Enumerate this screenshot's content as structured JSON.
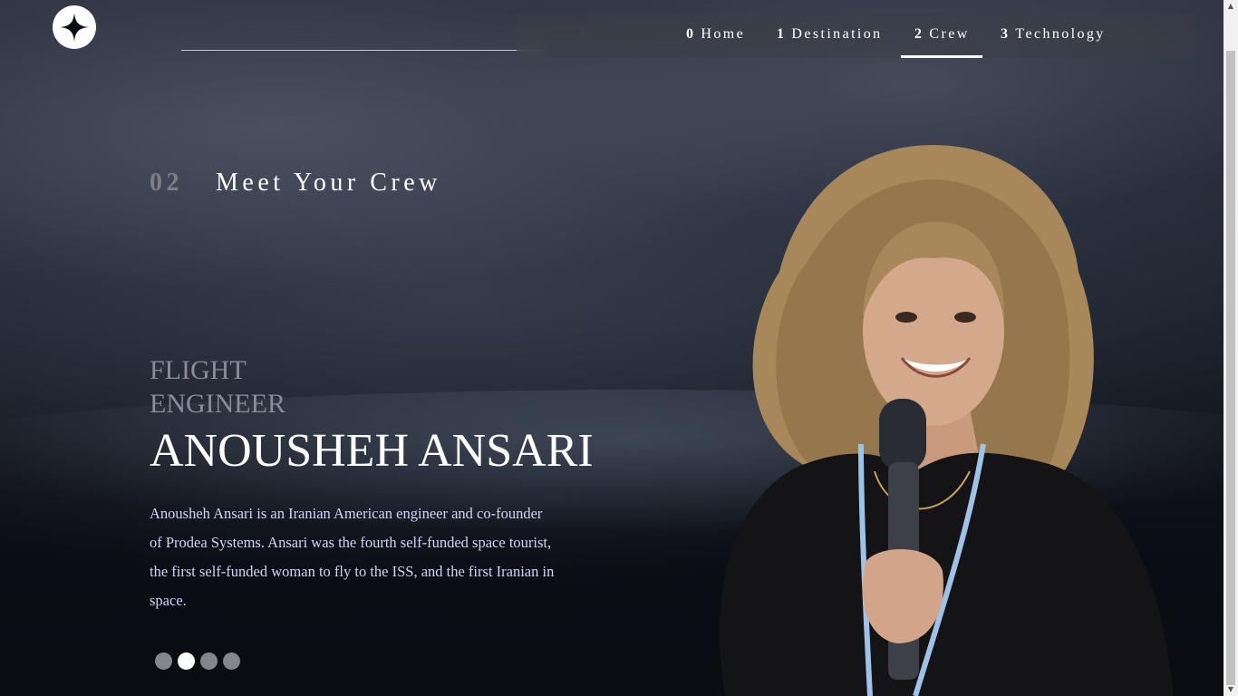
{
  "nav": {
    "items": [
      {
        "num": "0",
        "label": "Home"
      },
      {
        "num": "1",
        "label": "Destination"
      },
      {
        "num": "2",
        "label": "Crew"
      },
      {
        "num": "3",
        "label": "Technology"
      }
    ],
    "active_index": 2
  },
  "heading": {
    "num": "02",
    "title": "Meet Your Crew"
  },
  "crew": {
    "role_line1": "FLIGHT",
    "role_line2": "ENGINEER",
    "name": "ANOUSHEH ANSARI",
    "bio": "Anousheh Ansari is an Iranian American engineer and co-founder of Prodea Systems. Ansari was the fourth self-funded space tourist, the first self-funded woman to fly to the ISS, and the first Iranian in space."
  },
  "slider": {
    "count": 4,
    "active_index": 1
  },
  "colors": {
    "accent": "#ffffff",
    "muted": "#8c8d93",
    "bio": "#d0d6f9"
  }
}
